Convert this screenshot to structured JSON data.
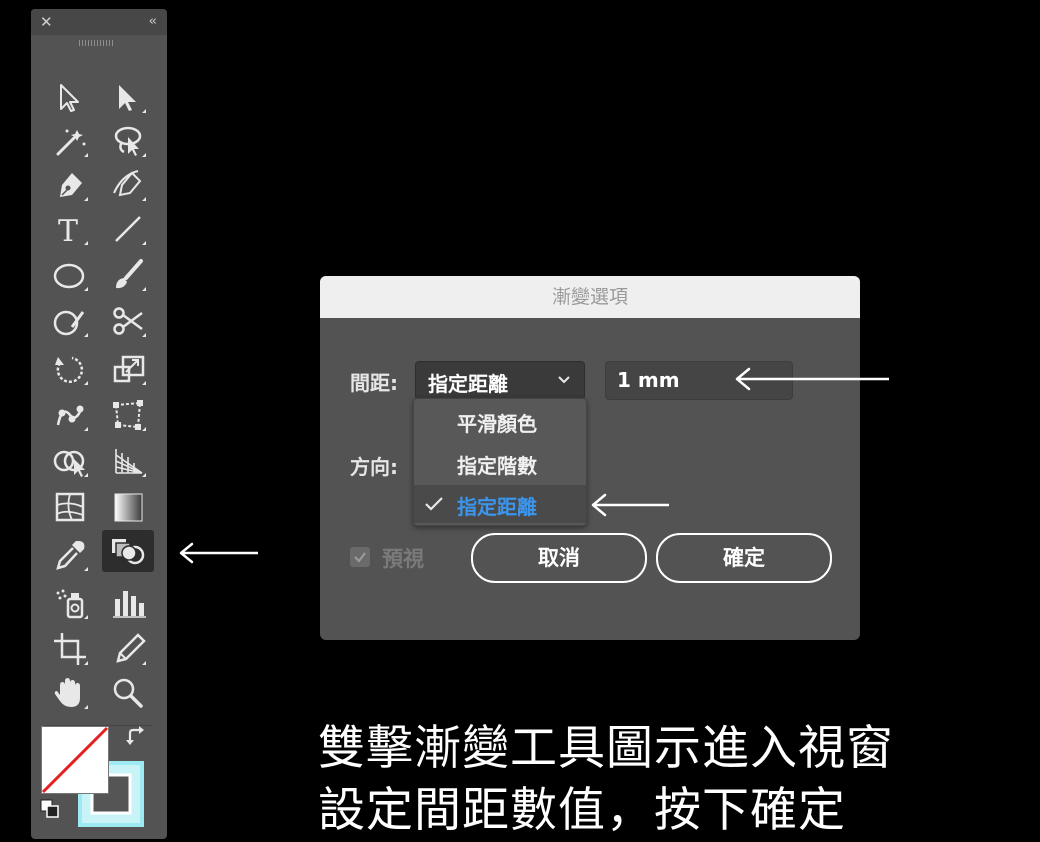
{
  "toolbar": {
    "close_glyph": "✕",
    "collapse_glyph": "‹‹",
    "tools": [
      {
        "id": "selection",
        "icon": "selection-arrow-icon"
      },
      {
        "id": "direct-selection",
        "icon": "direct-selection-arrow-icon"
      },
      {
        "id": "magic-wand",
        "icon": "magic-wand-icon"
      },
      {
        "id": "lasso",
        "icon": "lasso-icon"
      },
      {
        "id": "pen",
        "icon": "pen-icon"
      },
      {
        "id": "curvature",
        "icon": "curvature-pen-icon"
      },
      {
        "id": "type",
        "icon": "type-icon",
        "glyph": "T"
      },
      {
        "id": "line",
        "icon": "line-segment-icon"
      },
      {
        "id": "ellipse",
        "icon": "ellipse-icon"
      },
      {
        "id": "brush",
        "icon": "paintbrush-icon"
      },
      {
        "id": "shaper",
        "icon": "shaper-icon"
      },
      {
        "id": "scissors",
        "icon": "scissors-icon"
      },
      {
        "id": "rotate",
        "icon": "rotate-icon"
      },
      {
        "id": "scale",
        "icon": "scale-icon"
      },
      {
        "id": "puppet-warp",
        "icon": "puppet-warp-icon"
      },
      {
        "id": "free-transform",
        "icon": "free-transform-icon"
      },
      {
        "id": "shape-builder",
        "icon": "shape-builder-icon"
      },
      {
        "id": "perspective-grid",
        "icon": "perspective-grid-icon"
      },
      {
        "id": "mesh",
        "icon": "mesh-icon"
      },
      {
        "id": "gradient",
        "icon": "gradient-icon"
      },
      {
        "id": "eyedropper",
        "icon": "eyedropper-icon"
      },
      {
        "id": "blend",
        "icon": "blend-icon",
        "active": true
      },
      {
        "id": "symbol-sprayer",
        "icon": "symbol-sprayer-icon"
      },
      {
        "id": "column-graph",
        "icon": "column-graph-icon"
      },
      {
        "id": "artboard",
        "icon": "artboard-icon"
      },
      {
        "id": "slice",
        "icon": "slice-icon"
      },
      {
        "id": "hand",
        "icon": "hand-icon"
      },
      {
        "id": "zoom",
        "icon": "zoom-icon"
      }
    ],
    "colors": {
      "fill": "#ffffff",
      "stroke_inner": "#555555",
      "stroke_outer": "#9eeaf2",
      "none_slash": "#e32020"
    }
  },
  "dialog": {
    "title": "漸變選項",
    "spacing_label": "間距:",
    "spacing_selected": "指定距離",
    "distance_value": "1 mm",
    "orientation_label": "方向:",
    "menu_options": [
      {
        "label": "平滑顏色",
        "selected": false
      },
      {
        "label": "指定階數",
        "selected": false
      },
      {
        "label": "指定距離",
        "selected": true
      }
    ],
    "preview_label": "預視",
    "preview_checked": true,
    "cancel_label": "取消",
    "ok_label": "確定",
    "accent_color": "#3b95ec"
  },
  "caption": {
    "line1": "雙擊漸變工具圖示進入視窗",
    "line2": "設定間距數值，按下確定"
  }
}
